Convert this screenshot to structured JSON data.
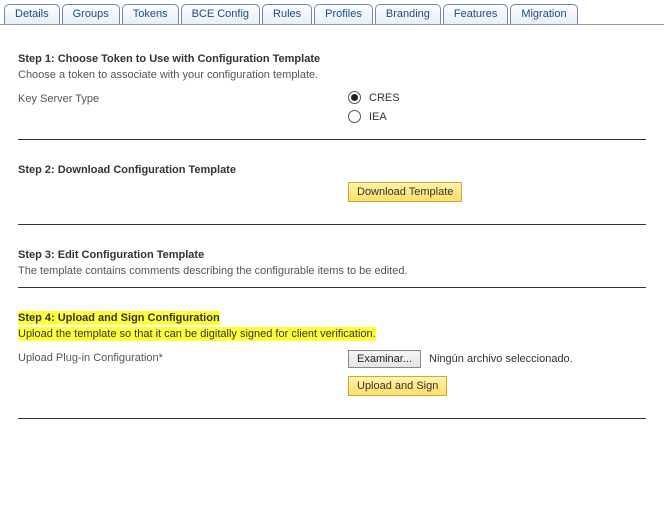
{
  "tabs": {
    "details": "Details",
    "groups": "Groups",
    "tokens": "Tokens",
    "bce": "BCE Config",
    "rules": "Rules",
    "profiles": "Profiles",
    "branding": "Branding",
    "features": "Features",
    "migration": "Migration"
  },
  "step1": {
    "title": "Step 1: Choose Token to Use with Configuration Template",
    "desc": "Choose a token to associate with your configuration template.",
    "field_label": "Key Server Type",
    "options": {
      "cres": "CRES",
      "iea": "IEA"
    }
  },
  "step2": {
    "title": "Step 2: Download Configuration Template",
    "button": "Download Template"
  },
  "step3": {
    "title": "Step 3: Edit Configuration Template",
    "desc": "The template contains comments describing the configurable items to be edited."
  },
  "step4": {
    "title": "Step 4: Upload and Sign Configuration",
    "desc": "Upload the template so that it can be digitally signed for client verification.",
    "field_label": "Upload Plug-in Configuration*",
    "browse_button": "Examinar...",
    "file_status": "Ningún archivo seleccionado.",
    "submit_button": "Upload and Sign"
  }
}
